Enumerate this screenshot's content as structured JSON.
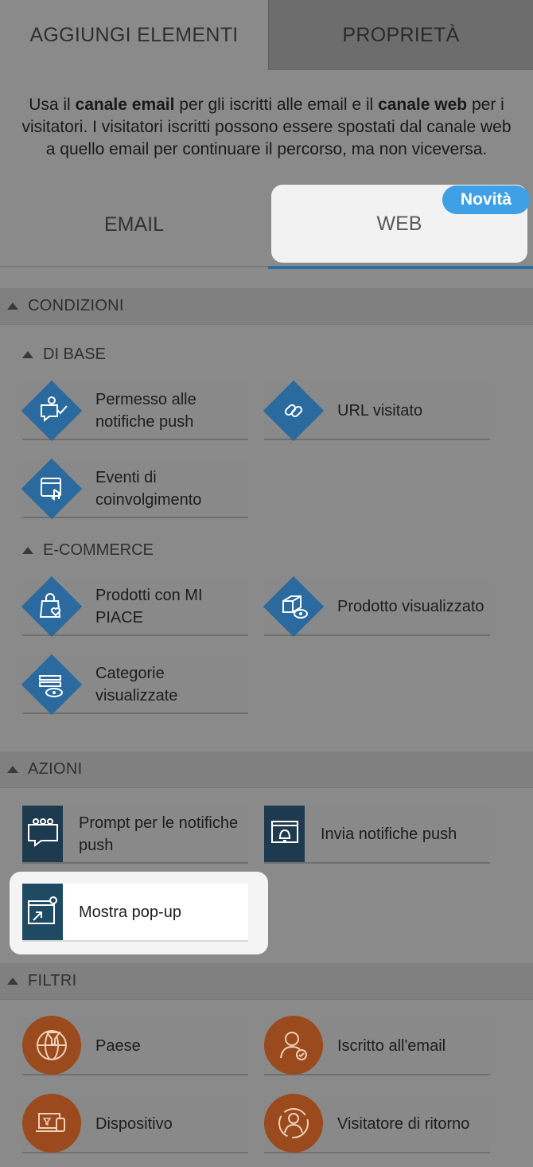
{
  "top_tabs": {
    "add": "AGGIUNGI ELEMENTI",
    "props": "PROPRIETÀ"
  },
  "intro": {
    "p1": "Usa il ",
    "b1": "canale email",
    "p2": " per gli iscritti alle email e il ",
    "b2": "canale web",
    "p3": " per i visitatori. I visitatori iscritti possono essere spostati dal canale web a quello email per continuare il percorso, ma non viceversa."
  },
  "channels": {
    "email": "EMAIL",
    "web": "WEB",
    "badge": "Novità"
  },
  "sections": {
    "conditions": "CONDIZIONI",
    "basic": "DI BASE",
    "ecommerce": "E-COMMERCE",
    "actions": "AZIONI",
    "filters": "FILTRI"
  },
  "basic_items": [
    {
      "label": "Permesso alle notifiche push",
      "icon": "chat-check-icon"
    },
    {
      "label": "URL visitato",
      "icon": "link-icon"
    },
    {
      "label": "Eventi di coinvolgimento",
      "icon": "tap-icon"
    }
  ],
  "ecom_items": [
    {
      "label": "Prodotti con MI PIACE",
      "icon": "bag-heart-icon"
    },
    {
      "label": "Prodotto visualizzato",
      "icon": "box-eye-icon"
    },
    {
      "label": "Categorie visualizzate",
      "icon": "list-eye-icon"
    }
  ],
  "action_items": [
    {
      "label": "Prompt per le notifiche push",
      "icon": "prompt-icon"
    },
    {
      "label": "Invia notifiche push",
      "icon": "bell-window-icon"
    },
    {
      "label": "Mostra pop-up",
      "icon": "popup-icon"
    }
  ],
  "filter_items": [
    {
      "label": "Paese",
      "icon": "globe-funnel-icon"
    },
    {
      "label": "Iscritto all'email",
      "icon": "user-check-icon"
    },
    {
      "label": "Dispositivo",
      "icon": "devices-icon"
    },
    {
      "label": "Visitatore di ritorno",
      "icon": "returning-user-icon"
    }
  ],
  "colors": {
    "accent": "#2f6e9e",
    "badge": "#3fa0e6",
    "condition": "#2a6a9e",
    "action": "#1e3a4e",
    "filter": "#9a4a1c"
  }
}
